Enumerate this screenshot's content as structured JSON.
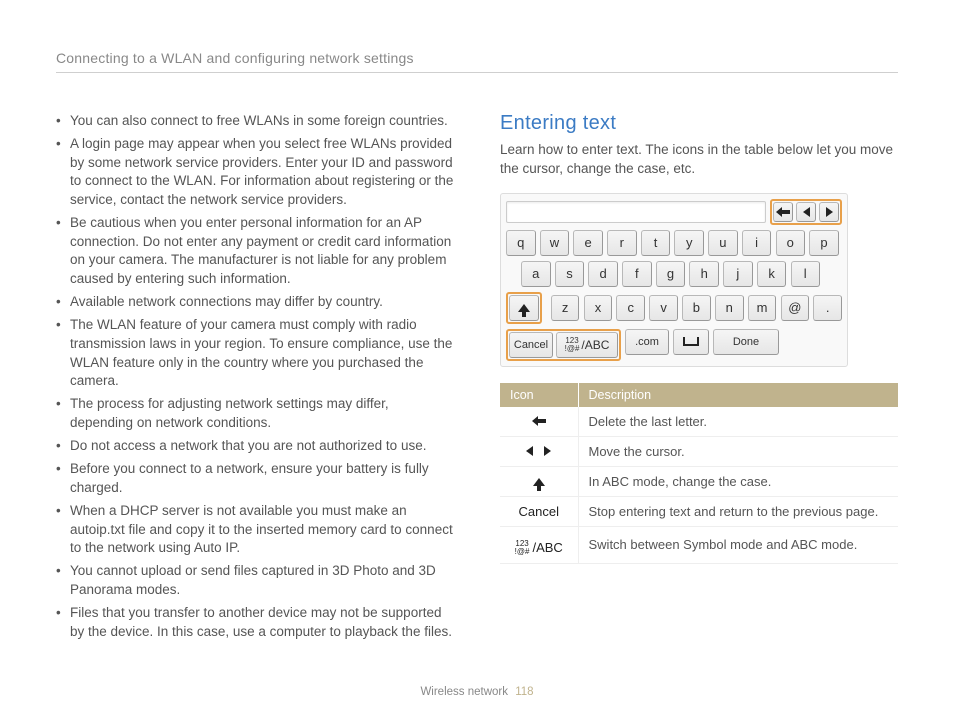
{
  "header": "Connecting to a WLAN and configuring network settings",
  "bullets": [
    "You can also connect to free WLANs in some foreign countries.",
    "A login page may appear when you select free WLANs provided by some network service providers. Enter your ID and password to connect to the WLAN. For information about registering or the service, contact the network service providers.",
    "Be cautious when you enter personal information for an AP connection. Do not enter any payment or credit card information on your camera. The manufacturer is not liable for any problem caused by entering such information.",
    "Available network connections may differ by country.",
    "The WLAN feature of your camera must comply with radio transmission laws in your region. To ensure compliance, use the WLAN feature only in the country where you purchased the camera.",
    "The process for adjusting network settings may differ, depending on network conditions.",
    "Do not access a network that you are not authorized to use.",
    "Before you connect to a network, ensure your battery is fully charged.",
    "When a DHCP server is not available you must make an autoip.txt file and copy it to the inserted memory card to connect to the network using Auto IP.",
    "You cannot upload or send files captured in 3D Photo and 3D Panorama modes.",
    "Files that you transfer to another device may not be supported by the device. In this case, use a computer to playback the files."
  ],
  "section_heading": "Entering text",
  "section_intro": "Learn how to enter text. The icons in the table below let you move the cursor, change the case, etc.",
  "keyboard": {
    "row1": [
      "q",
      "w",
      "e",
      "r",
      "t",
      "y",
      "u",
      "i",
      "o",
      "p"
    ],
    "row2": [
      "a",
      "s",
      "d",
      "f",
      "g",
      "h",
      "j",
      "k",
      "l"
    ],
    "row3": [
      "z",
      "x",
      "c",
      "v",
      "b",
      "n",
      "m",
      "@",
      "."
    ],
    "cancel": "Cancel",
    "mode": "/ABC",
    "com": ".com",
    "done": "Done"
  },
  "table": {
    "headers": [
      "Icon",
      "Description"
    ],
    "rows": [
      {
        "icon": "back",
        "desc": "Delete the last letter."
      },
      {
        "icon": "cursor",
        "desc": "Move the cursor."
      },
      {
        "icon": "shift",
        "desc": "In ABC mode, change the case."
      },
      {
        "icon": "cancel",
        "label": "Cancel",
        "desc": "Stop entering text and return to the previous page."
      },
      {
        "icon": "mode",
        "label": "/ABC",
        "desc": "Switch between Symbol mode and ABC mode."
      }
    ]
  },
  "footer": {
    "section": "Wireless network",
    "page": "118"
  }
}
